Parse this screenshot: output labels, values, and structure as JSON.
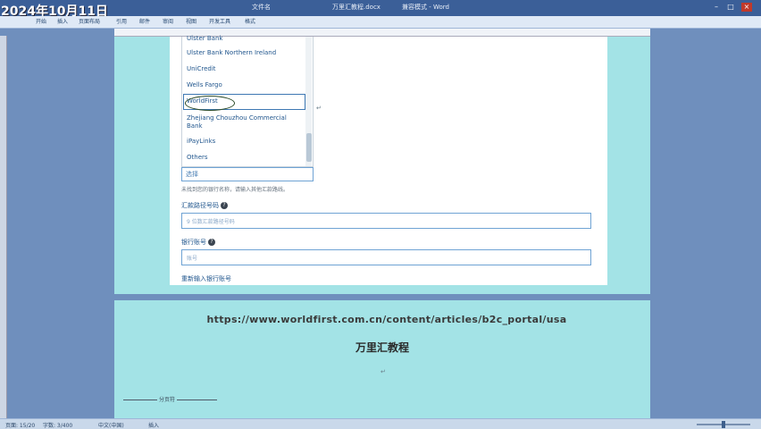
{
  "overlay": {
    "date": "2024年10月11日"
  },
  "window": {
    "title_left": "文件名",
    "title_mid": "万里汇教程.docx",
    "title_right": "兼容模式 - Word"
  },
  "ribbon": {
    "tabs": [
      "开始",
      "插入",
      "页面布局",
      "引用",
      "邮件",
      "审阅",
      "视图",
      "开发工具",
      "格式"
    ]
  },
  "dropdown": {
    "items": [
      "Ulster Bank",
      "Ulster Bank Northern Ireland",
      "UniCredit",
      "Wells Fargo",
      "WorldFirst",
      "Zhejiang Chouzhou Commercial Bank",
      "iPayLinks",
      "Others"
    ],
    "selected": "WorldFirst"
  },
  "form": {
    "select_placeholder": "选择",
    "hint": "未找到您的银行名称，请输入其他汇款路线。",
    "routing_label": "汇款路径号码",
    "routing_placeholder": "9 位数汇款路径号码",
    "account_label": "银行账号",
    "account_placeholder": "账号",
    "reenter_label": "重新输入银行账号"
  },
  "page2": {
    "url": "https://www.worldfirst.com.cn/content/articles/b2c_portal/usa",
    "title": "万里汇教程",
    "section_break": "分页符"
  },
  "status": {
    "page": "页面: 15/20",
    "words": "字数: 3/400",
    "language": "中文(中国)",
    "mode": "插入"
  },
  "colors": {
    "page_bg": "#a3e3e6",
    "app_bg": "#6f8fbd",
    "link_blue": "#22578e",
    "input_border": "#6fa3d4"
  }
}
